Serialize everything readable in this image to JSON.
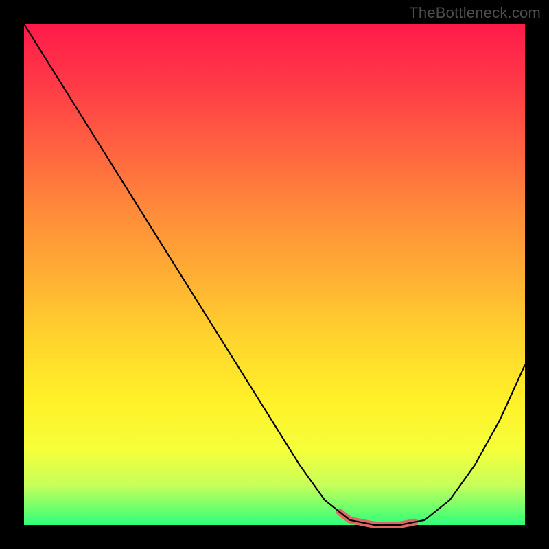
{
  "watermark": "TheBottleneck.com",
  "colors": {
    "background": "#000000",
    "gradient_top": "#ff1a4a",
    "gradient_bottom": "#2eff7a",
    "curve": "#000000",
    "highlight": "#e06666"
  },
  "chart_data": {
    "type": "line",
    "title": "",
    "xlabel": "",
    "ylabel": "",
    "xlim": [
      0,
      100
    ],
    "ylim": [
      0,
      100
    ],
    "series": [
      {
        "name": "bottleneck-curve",
        "x": [
          0,
          5,
          10,
          15,
          20,
          25,
          30,
          35,
          40,
          45,
          50,
          55,
          60,
          65,
          70,
          75,
          80,
          85,
          90,
          95,
          100
        ],
        "values": [
          100,
          92,
          84,
          76,
          68,
          60,
          52,
          44,
          36,
          28,
          20,
          12,
          5,
          1,
          0,
          0,
          1,
          5,
          12,
          21,
          32
        ]
      }
    ],
    "highlight_range_x": [
      63,
      78
    ],
    "annotations": []
  }
}
